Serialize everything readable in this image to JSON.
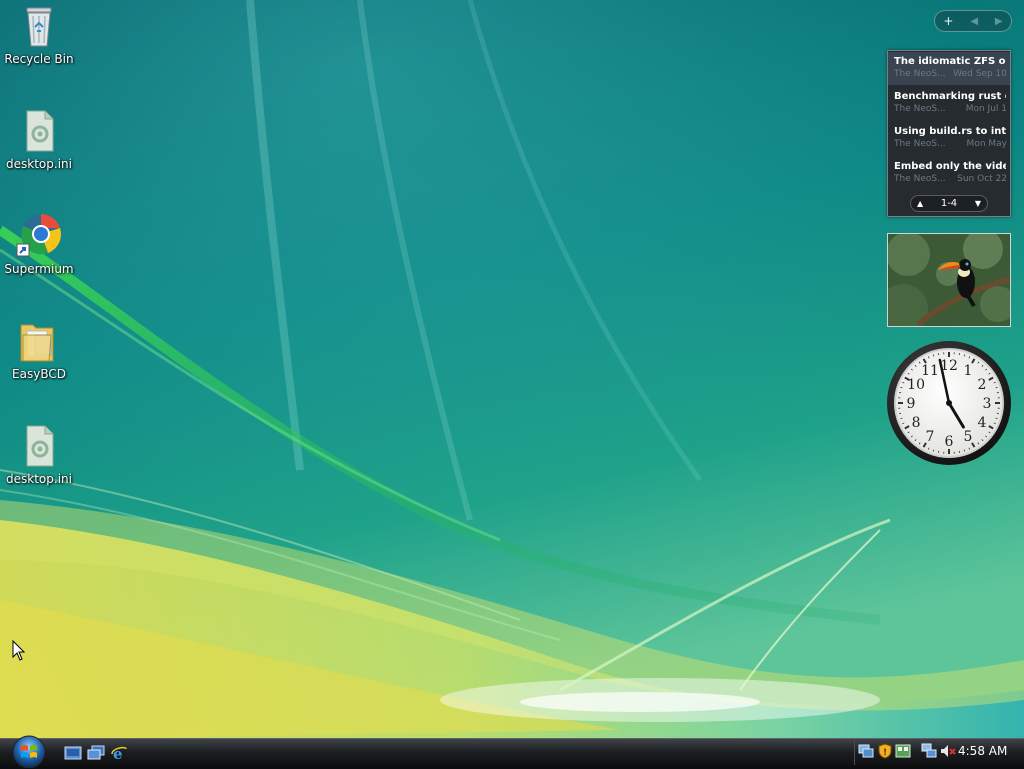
{
  "desktop": {
    "icons": [
      {
        "label": "Recycle Bin",
        "icon": "recycle-bin-icon"
      },
      {
        "label": "desktop.ini",
        "icon": "settings-file-icon"
      },
      {
        "label": "Supermium",
        "icon": "browser-shortcut-icon"
      },
      {
        "label": "EasyBCD",
        "icon": "folder-icon"
      },
      {
        "label": "desktop.ini",
        "icon": "settings-file-icon"
      }
    ]
  },
  "sidebar": {
    "controls": {
      "add": "+",
      "prev": "◀",
      "next": "▶"
    },
    "feed": {
      "items": [
        {
          "title": "The idiomatic ZFS on...",
          "source": "The NeoS...",
          "date": "Wed Sep 10"
        },
        {
          "title": "Benchmarking rust c...",
          "source": "The NeoS...",
          "date": "Mon Jul 1"
        },
        {
          "title": "Using build.rs to inte...",
          "source": "The NeoS...",
          "date": "Mon May"
        },
        {
          "title": "Embed only the vide...",
          "source": "The NeoS...",
          "date": "Sun Oct 22"
        }
      ],
      "pager": {
        "label": "1-4",
        "up": "▲",
        "down": "▼"
      }
    },
    "slideshow": {
      "subject": "toucan-photo"
    },
    "clock": {
      "numerals": [
        "12",
        "1",
        "2",
        "3",
        "4",
        "5",
        "6",
        "7",
        "8",
        "9",
        "10",
        "11"
      ],
      "hour": 4,
      "minute": 58
    }
  },
  "taskbar": {
    "start": "start-orb",
    "quick_launch": [
      "show-desktop-icon",
      "switch-windows-icon",
      "internet-explorer-icon"
    ],
    "tray": [
      "network-status-icon",
      "security-shield-icon",
      "windows-update-icon",
      "network-icon",
      "volume-muted-icon"
    ],
    "time": "4:58 AM"
  },
  "colors": {
    "taskbar": "#1b1d20",
    "gadget_bg": "#262b30",
    "wallpaper": "#0a6f72"
  }
}
